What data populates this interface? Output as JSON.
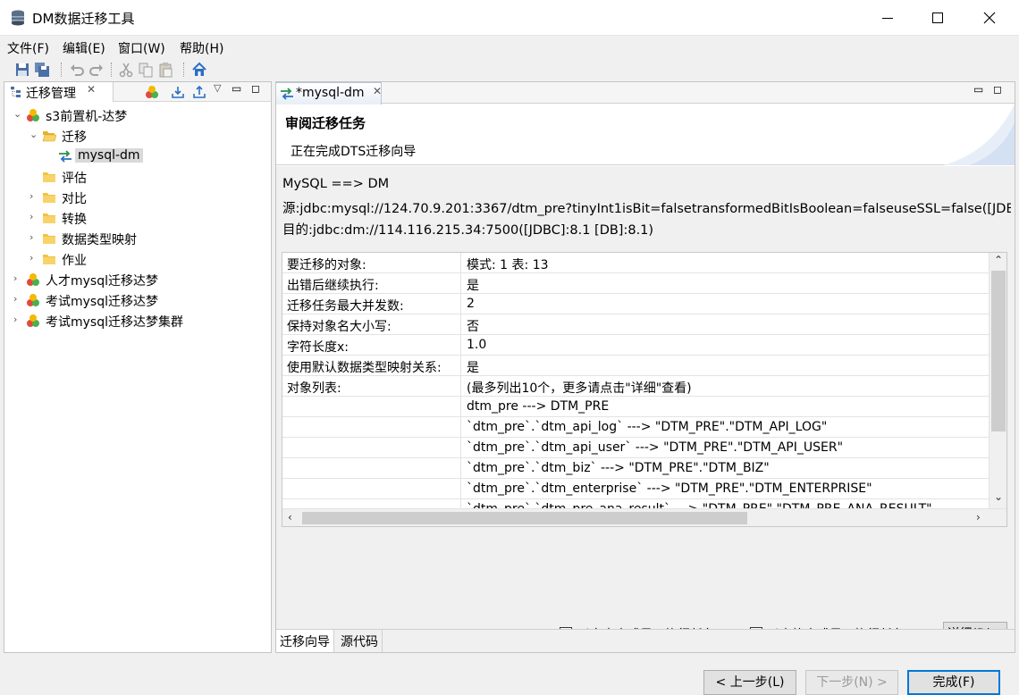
{
  "window": {
    "title": "DM数据迁移工具"
  },
  "menu": [
    "文件(F)",
    "编辑(E)",
    "窗口(W)",
    "帮助(H)"
  ],
  "toolbar": {
    "icons": [
      "save-icon",
      "save-all-icon",
      "undo-icon",
      "redo-icon",
      "cut-icon",
      "copy-icon",
      "paste-icon",
      "home-icon"
    ]
  },
  "left_panel": {
    "tab_label": "迁移管理",
    "tree": [
      {
        "label": "s3前置机-达梦",
        "level": 0,
        "expanded": true,
        "icon": "project-icon"
      },
      {
        "label": "迁移",
        "level": 1,
        "expanded": true,
        "icon": "folder-open-icon"
      },
      {
        "label": "mysql-dm",
        "level": 2,
        "icon": "migration-icon",
        "selected": true
      },
      {
        "label": "评估",
        "level": 1,
        "icon": "folder-icon"
      },
      {
        "label": "对比",
        "level": 1,
        "expanded": false,
        "icon": "folder-icon"
      },
      {
        "label": "转换",
        "level": 1,
        "expanded": false,
        "icon": "folder-icon"
      },
      {
        "label": "数据类型映射",
        "level": 1,
        "expanded": false,
        "icon": "folder-icon"
      },
      {
        "label": "作业",
        "level": 1,
        "expanded": false,
        "icon": "folder-icon"
      },
      {
        "label": "人才mysql迁移达梦",
        "level": 0,
        "expanded": false,
        "icon": "project-icon"
      },
      {
        "label": "考试mysql迁移达梦",
        "level": 0,
        "expanded": false,
        "icon": "project-icon"
      },
      {
        "label": "考试mysql迁移达梦集群",
        "level": 0,
        "expanded": false,
        "icon": "project-icon"
      }
    ]
  },
  "editor": {
    "tab_label": "*mysql-dm",
    "wizard_title": "审阅迁移任务",
    "wizard_subtitle": "正在完成DTS迁移向导",
    "direction": "MySQL ==> DM",
    "source": "源:jdbc:mysql://124.70.9.201:3367/dtm_pre?tinyInt1isBit=falsetransformedBitIsBoolean=falseuseSSL=false([JDBC",
    "target": "目的:jdbc:dm://114.116.215.34:7500([JDBC]:8.1 [DB]:8.1)",
    "grid_rows": [
      {
        "key": "要迁移的对象:",
        "value": "模式: 1 表: 13"
      },
      {
        "key": "出错后继续执行:",
        "value": "是"
      },
      {
        "key": "迁移任务最大并发数:",
        "value": "2"
      },
      {
        "key": "保持对象名大小写:",
        "value": "否"
      },
      {
        "key": "字符长度x:",
        "value": "1.0"
      },
      {
        "key": "使用默认数据类型映射关系:",
        "value": "是"
      },
      {
        "key": "对象列表:",
        "value": "(最多列出10个，更多请点击\"详细\"查看)"
      },
      {
        "key": "",
        "value": "dtm_pre ---> DTM_PRE"
      },
      {
        "key": "",
        "value": "`dtm_pre`.`dtm_api_log` ---> \"DTM_PRE\".\"DTM_API_LOG\""
      },
      {
        "key": "",
        "value": "`dtm_pre`.`dtm_api_user` ---> \"DTM_PRE\".\"DTM_API_USER\""
      },
      {
        "key": "",
        "value": "`dtm_pre`.`dtm_biz` ---> \"DTM_PRE\".\"DTM_BIZ\""
      },
      {
        "key": "",
        "value": "`dtm_pre`.`dtm_enterprise` ---> \"DTM_PRE\".\"DTM_ENTERPRISE\""
      },
      {
        "key": "",
        "value": "`dtm_pre`.`dtm_pre_ana_result` ---> \"DTM_PRE\".\"DTM_PRE_ANA_RESULT\""
      }
    ],
    "checkbox_text_mode": "以文本方式显示执行任务(E)",
    "checkbox_table_mode": "以表格方式显示执行任务(Z)",
    "detail_button": "详细(D)...",
    "back_button": "< 上一步(L)",
    "next_button": "下一步(N) >",
    "finish_button": "完成(F)",
    "bottom_tabs": [
      "迁移向导",
      "源代码"
    ]
  }
}
